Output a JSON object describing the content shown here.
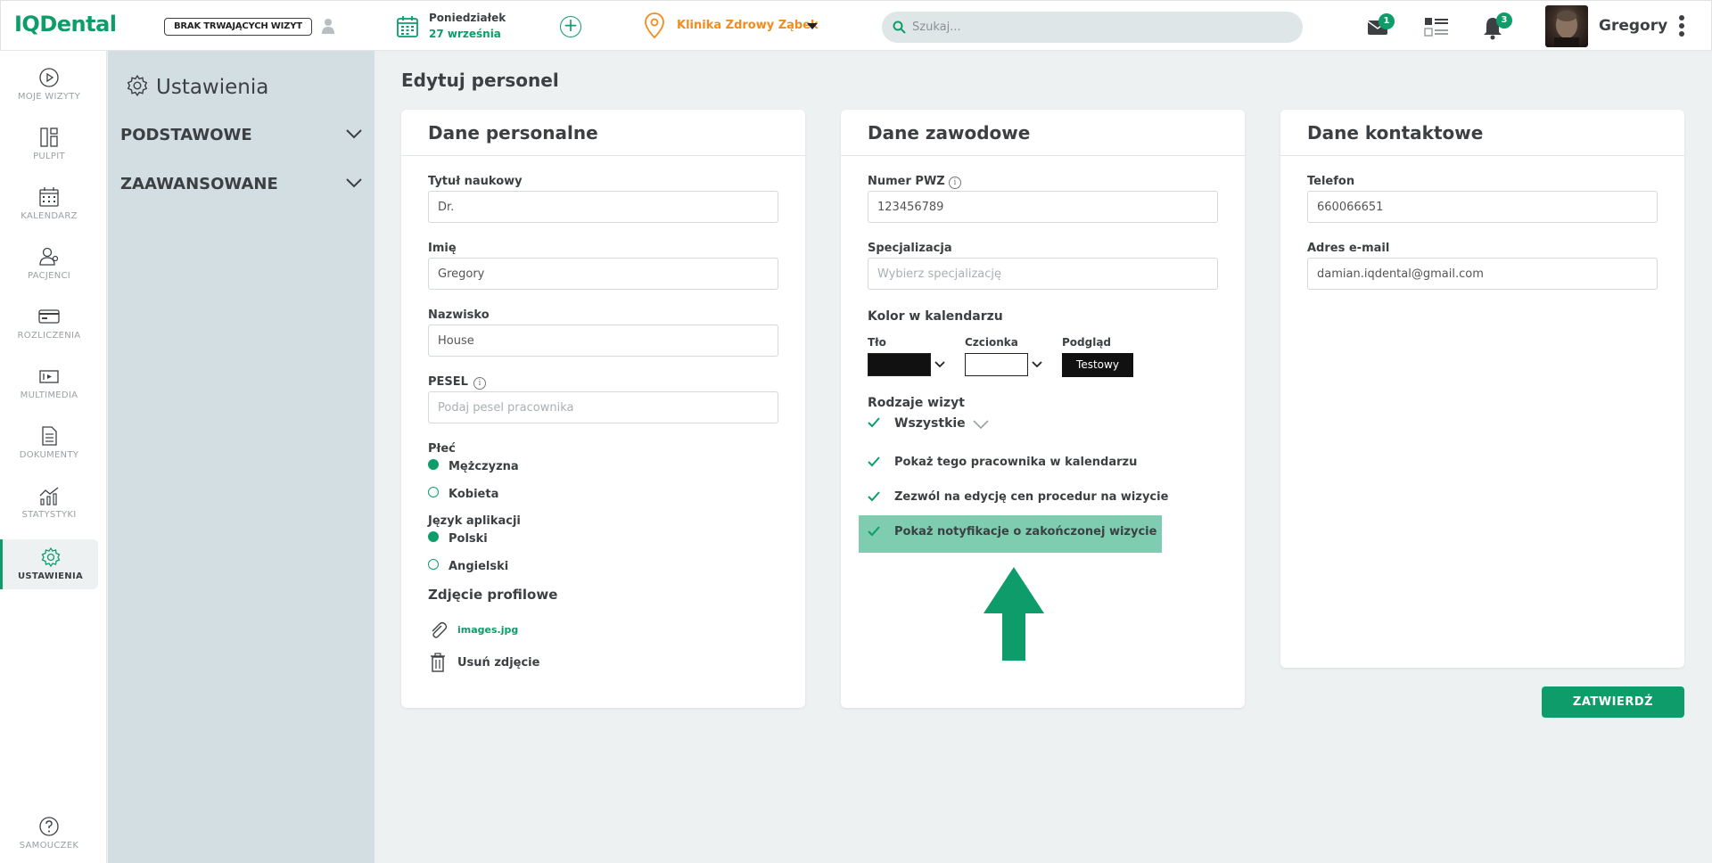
{
  "app": {
    "logo": "IQDental"
  },
  "topbar": {
    "visit_status": "BRAK TRWAJĄCYCH WIZYT",
    "date_day": "Poniedziałek",
    "date_date": "27 września",
    "clinic": "Klinika Zdrowy Ząbek",
    "search_placeholder": "Szukaj...",
    "mail_count": "1",
    "notifications_count": "3",
    "username": "Gregory",
    "accent_color": "#0e9d6a",
    "clinic_color": "#f28c1b"
  },
  "nav": {
    "items": [
      {
        "label": "MOJE WIZYTY",
        "icon": "play-circle-icon"
      },
      {
        "label": "PULPIT",
        "icon": "dashboard-icon"
      },
      {
        "label": "KALENDARZ",
        "icon": "calendar-icon"
      },
      {
        "label": "PACJENCI",
        "icon": "patients-icon"
      },
      {
        "label": "ROZLICZENIA",
        "icon": "card-icon"
      },
      {
        "label": "MULTIMEDIA",
        "icon": "media-icon"
      },
      {
        "label": "DOKUMENTY",
        "icon": "document-icon"
      },
      {
        "label": "STATYSTYKI",
        "icon": "stats-icon"
      },
      {
        "label": "USTAWIENIA",
        "icon": "gear-icon"
      }
    ],
    "help_label": "SAMOUCZEK"
  },
  "settings": {
    "title": "Ustawienia",
    "sections": [
      "PODSTAWOWE",
      "ZAAWANSOWANE"
    ]
  },
  "main": {
    "title": "Edytuj personel",
    "personal": {
      "heading": "Dane personalne",
      "title_label": "Tytuł naukowy",
      "title_value": "Dr.",
      "first_name_label": "Imię",
      "first_name_value": "Gregory",
      "last_name_label": "Nazwisko",
      "last_name_value": "House",
      "pesel_label": "PESEL",
      "pesel_placeholder": "Podaj pesel pracownika",
      "gender_label": "Płeć",
      "gender_options": [
        "Mężczyzna",
        "Kobieta"
      ],
      "gender_selected": "Mężczyzna",
      "lang_label": "Język aplikacji",
      "lang_options": [
        "Polski",
        "Angielski"
      ],
      "lang_selected": "Polski",
      "photo_label": "Zdjęcie profilowe",
      "photo_file": "images.jpg",
      "remove_photo": "Usuń zdjęcie"
    },
    "professional": {
      "heading": "Dane zawodowe",
      "pwz_label": "Numer PWZ",
      "pwz_value": "123456789",
      "spec_label": "Specjalizacja",
      "spec_placeholder": "Wybierz specjalizację",
      "color_label": "Kolor w kalendarzu",
      "bg_label": "Tło",
      "bg_color": "#111111",
      "font_label": "Czcionka",
      "font_color": "#ffffff",
      "preview_label": "Podgląd",
      "preview_text": "Testowy",
      "visit_types_label": "Rodzaje wizyt",
      "visit_types_value": "Wszystkie",
      "options": [
        "Pokaż tego pracownika w kalendarzu",
        "Zezwól na edycję cen procedur na wizycie",
        "Pokaż notyfikacje o zakończonej wizycie"
      ]
    },
    "contact": {
      "heading": "Dane kontaktowe",
      "phone_label": "Telefon",
      "phone_value": "660066651",
      "email_label": "Adres e-mail",
      "email_value": "damian.iqdental@gmail.com"
    },
    "submit": "ZATWIERDŹ"
  }
}
